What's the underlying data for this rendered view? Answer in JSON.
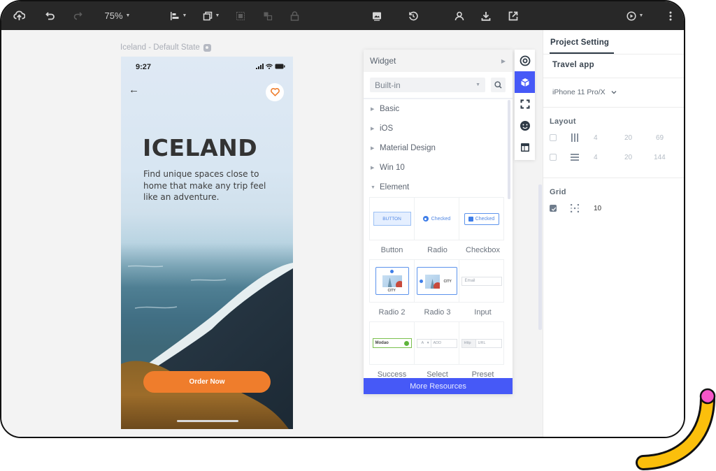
{
  "toolbar": {
    "zoom_level": "75%",
    "icons": [
      "upload-cloud-icon",
      "undo-icon",
      "redo-icon",
      "align-left-icon",
      "arrange-icon",
      "group-icon",
      "ungroup-icon",
      "lock-icon",
      "image-icon",
      "history-icon",
      "user-icon",
      "download-icon",
      "export-icon",
      "play-icon",
      "more-vertical-icon"
    ]
  },
  "canvas": {
    "state_label": "Iceland - Default State"
  },
  "phone": {
    "time": "9:27",
    "title": "ICELAND",
    "subtitle": "Find unique spaces close to home that make any trip feel like an adventure.",
    "cta_label": "Order Now",
    "accent_color": "#ef7d2c"
  },
  "widget_panel": {
    "title": "Widget",
    "library_select": "Built-in",
    "categories": [
      {
        "label": "Basic",
        "expanded": false
      },
      {
        "label": "iOS",
        "expanded": false
      },
      {
        "label": "Material Design",
        "expanded": false
      },
      {
        "label": "Win 10",
        "expanded": false
      },
      {
        "label": "Element",
        "expanded": true
      }
    ],
    "widgets": [
      {
        "label": "Button",
        "preview": "BUTTON"
      },
      {
        "label": "Radio",
        "preview": "Checked"
      },
      {
        "label": "Checkbox",
        "preview": "Checked"
      },
      {
        "label": "Radio 2",
        "preview": "CITY"
      },
      {
        "label": "Radio 3",
        "preview": "CITY"
      },
      {
        "label": "Input",
        "preview": "Email"
      },
      {
        "label": "Success",
        "preview": "Modao"
      },
      {
        "label": "Select",
        "preview_a": "A",
        "preview_b": "ADD"
      },
      {
        "label": "Preset",
        "preview_a": "Http",
        "preview_b": "URL"
      }
    ],
    "more_resources_label": "More Resources",
    "accent_color": "#4659f7"
  },
  "right_panel": {
    "tab": "Project Setting",
    "project_name": "Travel app",
    "device": "iPhone 11 Pro/X",
    "layout_title": "Layout",
    "layout_rows": [
      {
        "checked": false,
        "icon": "columns-icon",
        "count": "4",
        "gutter": "20",
        "size": "69"
      },
      {
        "checked": false,
        "icon": "rows-icon",
        "count": "4",
        "gutter": "20",
        "size": "144"
      }
    ],
    "grid_title": "Grid",
    "grid": {
      "checked": true,
      "value": "10"
    }
  }
}
